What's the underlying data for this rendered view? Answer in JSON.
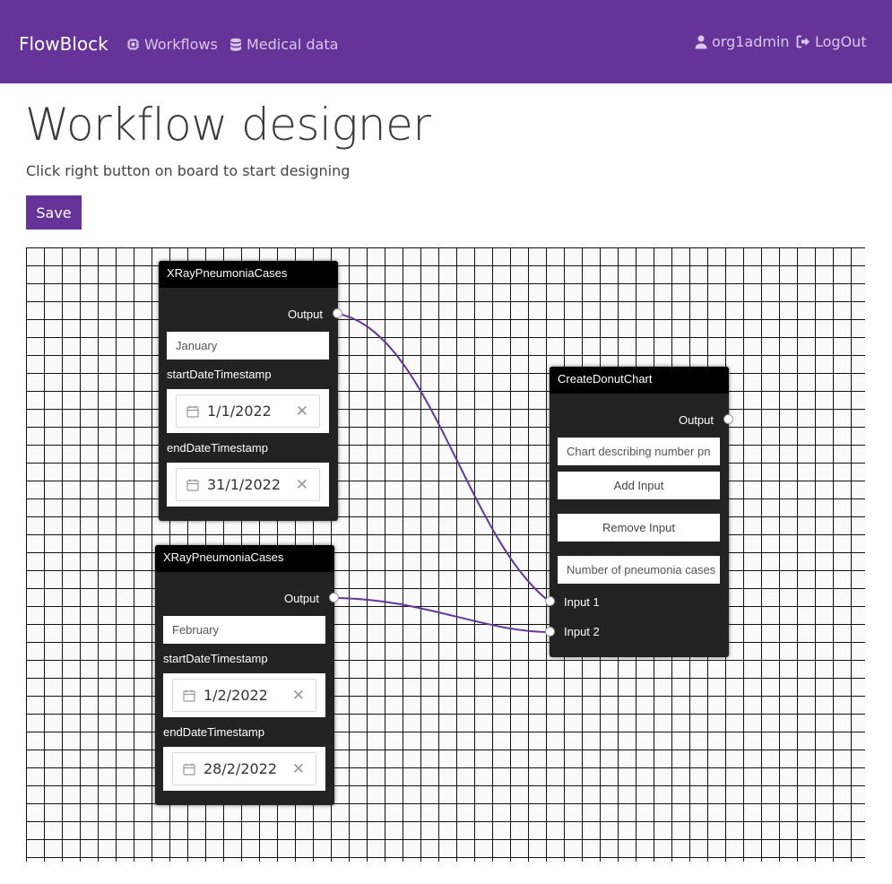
{
  "navbar": {
    "brand": "FlowBlock",
    "links": {
      "workflows": "Workflows",
      "medical_data": "Medical data"
    },
    "user": "org1admin",
    "logout": "LogOut"
  },
  "page": {
    "title": "Workflow designer",
    "subtitle": "Click right button on board to start designing",
    "save_label": "Save"
  },
  "nodes": {
    "xray1": {
      "title": "XRayPneumoniaCases",
      "output_label": "Output",
      "name_value": "January",
      "start_label": "startDateTimestamp",
      "start_value": "1/1/2022",
      "end_label": "endDateTimestamp",
      "end_value": "31/1/2022"
    },
    "xray2": {
      "title": "XRayPneumoniaCases",
      "output_label": "Output",
      "name_value": "February",
      "start_label": "startDateTimestamp",
      "start_value": "1/2/2022",
      "end_label": "endDateTimestamp",
      "end_value": "28/2/2022"
    },
    "donut": {
      "title": "CreateDonutChart",
      "output_label": "Output",
      "chart_title_value": "Chart describing number pn",
      "add_input_label": "Add Input",
      "remove_input_label": "Remove Input",
      "label_value": "Number of pneumonia cases",
      "input1_label": "Input 1",
      "input2_label": "Input 2"
    }
  },
  "colors": {
    "accent": "#663399",
    "node_bg": "#222222",
    "node_header": "#000000",
    "connection": "#663399"
  },
  "icons": {
    "workflows": "chip-icon",
    "medical_data": "database-icon",
    "user": "user-icon",
    "logout": "logout-icon",
    "date": "calendar-icon",
    "clear": "clear-icon"
  },
  "clear_glyph": "✕"
}
